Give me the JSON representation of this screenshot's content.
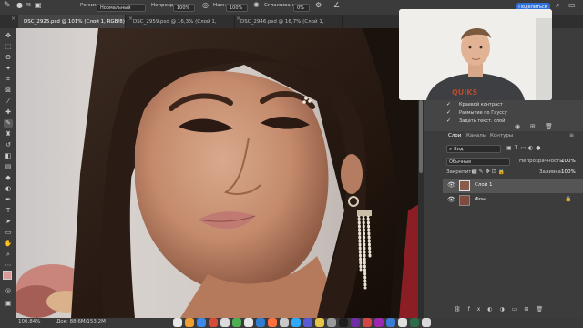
{
  "options_bar": {
    "mode_label": "Режим:",
    "mode_value": "Нормальный",
    "opacity_label": "Непрозр:",
    "opacity_value": "100%",
    "pressure_label": "Наж:",
    "pressure_value": "100%",
    "smoothing_label": "Сглаживание:",
    "smoothing_value": "0%",
    "share_label": "Поделиться"
  },
  "tabs": [
    {
      "label": "DSC_2925.psd @ 101% (Слой 1, RGB/8) *"
    },
    {
      "label": "DSC_2959.psd @ 16,3% (Слой 1, RGB/8)"
    },
    {
      "label": "DSC_2946.psd @ 16,7% (Слой 1, RGB/8)"
    }
  ],
  "history": {
    "items": [
      {
        "label": "Краевой контраст"
      },
      {
        "label": "Размытие по Гауссу"
      },
      {
        "label": "Задать текст. слой"
      }
    ]
  },
  "layers_panel": {
    "tabs": [
      {
        "label": "Слои"
      },
      {
        "label": "Каналы"
      },
      {
        "label": "Контуры"
      }
    ],
    "filter_label": "Вид",
    "blend_mode": "Обычные",
    "opacity_label": "Непрозрачность:",
    "opacity_value": "100%",
    "lock_label": "Закрепить:",
    "fill_label": "Заливка:",
    "fill_value": "100%",
    "layers": [
      {
        "name": "Слой 1"
      },
      {
        "name": "Фон"
      }
    ]
  },
  "status": {
    "zoom": "100,84%",
    "doc": "Док: 88,6М/153,2М"
  },
  "colors": {
    "accent": "#2e6fd9",
    "background": "#535353",
    "panel": "#3c3c3c"
  }
}
